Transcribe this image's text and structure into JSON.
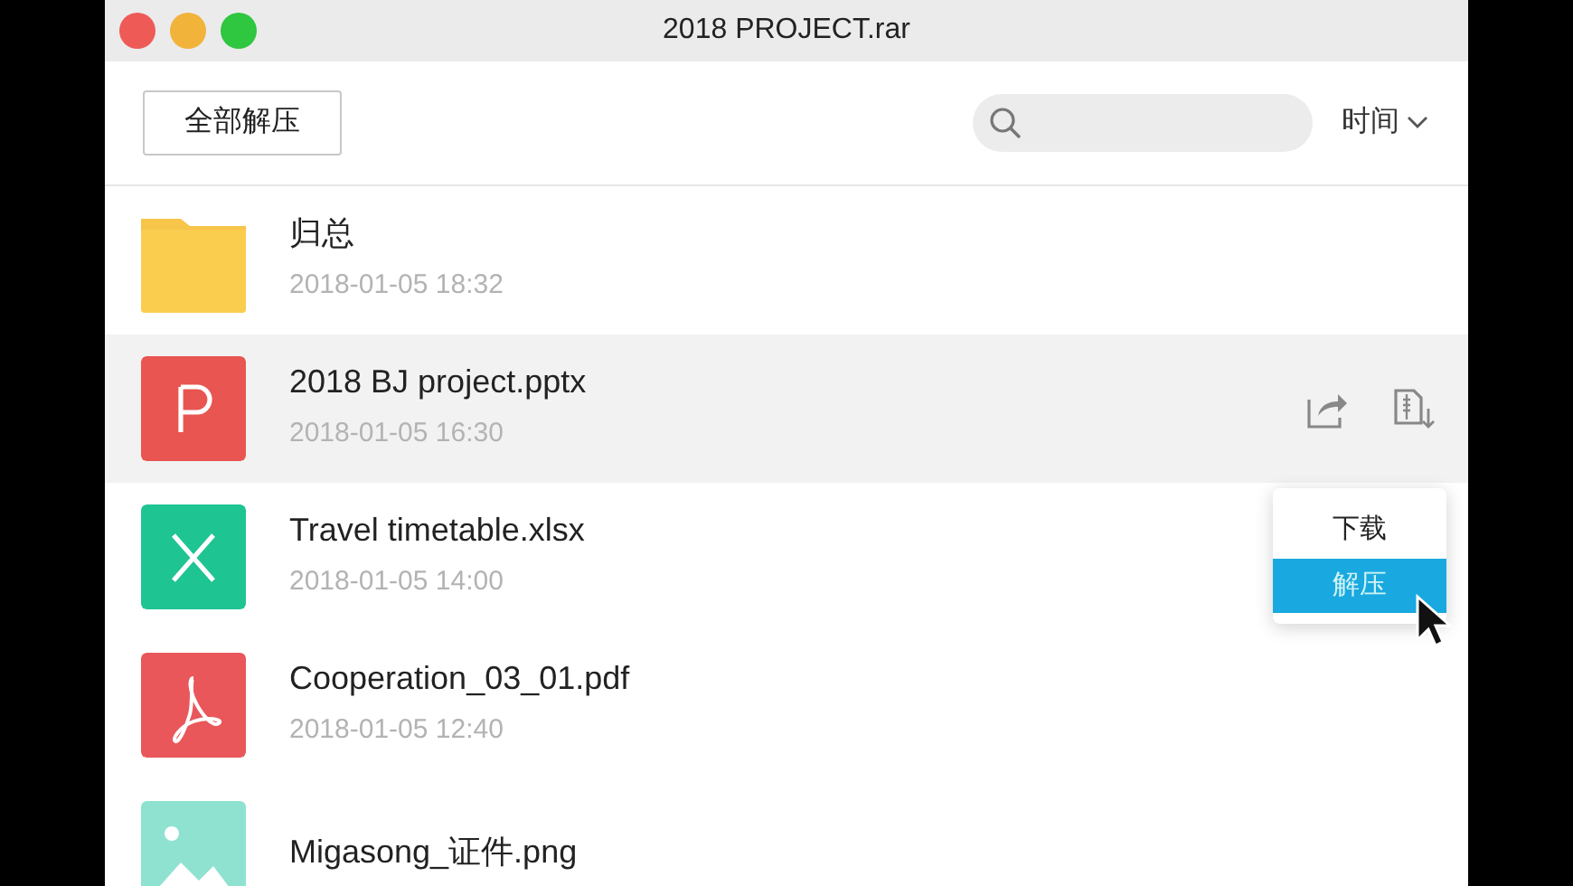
{
  "window": {
    "title": "2018 PROJECT.rar"
  },
  "toolbar": {
    "extract_all_button": "全部解压",
    "sort": "时间"
  },
  "files": [
    {
      "name": "归总",
      "date": "2018-01-05 18:32",
      "kind": "folder",
      "selected": false
    },
    {
      "name": "2018 BJ project.pptx",
      "date": "2018-01-05 16:30",
      "kind": "pptx",
      "selected": true
    },
    {
      "name": "Travel timetable.xlsx",
      "date": "2018-01-05 14:00",
      "kind": "xlsx",
      "selected": false
    },
    {
      "name": "Cooperation_03_01.pdf",
      "date": "2018-01-05 12:40",
      "kind": "pdf",
      "selected": false
    },
    {
      "name": "Migasong_证件.png",
      "kind": "png",
      "selected": false
    }
  ],
  "context_menu": [
    {
      "label": "下载",
      "selected": false
    },
    {
      "label": "解压",
      "selected": true
    }
  ]
}
